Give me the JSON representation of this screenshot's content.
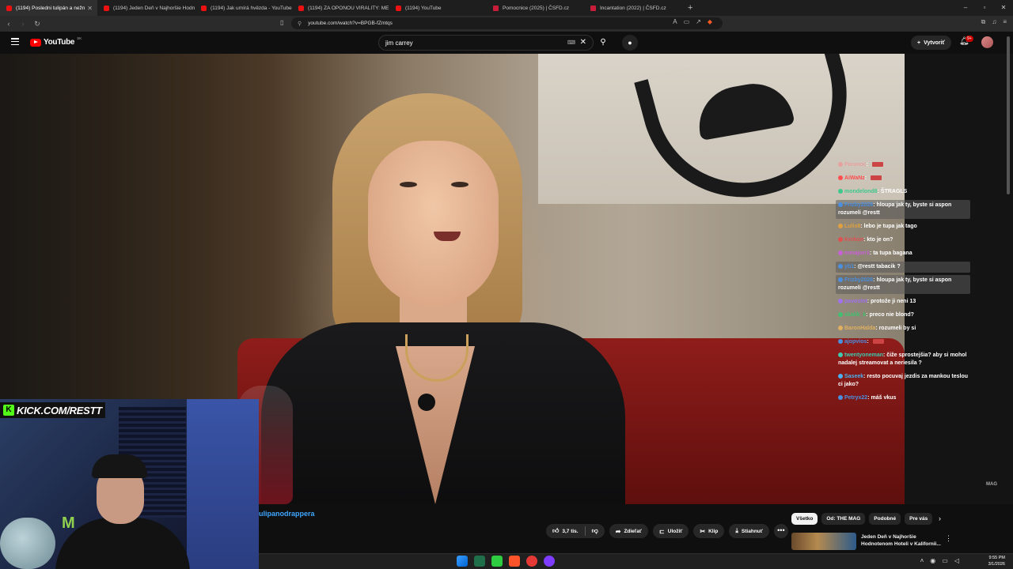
{
  "browser": {
    "tabs": [
      {
        "label": "(1194) Posledni tulipán a nežn",
        "active": true
      },
      {
        "label": "(1194) Jeden Deň v Najhoršie Hodno",
        "active": false
      },
      {
        "label": "(1194) Jak umírá hvězda - YouTube",
        "active": false
      },
      {
        "label": "(1194) ZA OPONOU VIRALITY: MEU",
        "active": false
      },
      {
        "label": "(1194) YouTube",
        "active": false
      },
      {
        "label": "Pomocnice (2025) | ČSFD.cz",
        "active": false
      },
      {
        "label": "Incantation (2022) | ČSFD.cz",
        "active": false
      }
    ],
    "new_tab": "+",
    "url": "youtube.com/watch?v=BPGB-fZmtqs",
    "window_controls": {
      "minimize": "–",
      "maximize": "▫",
      "close": "✕"
    }
  },
  "youtube": {
    "logo_text": "YouTube",
    "country_code": "SK",
    "search_value": "jim carrey",
    "create_label": "Vytvoriť",
    "notif_badge": "9+"
  },
  "chat": [
    {
      "user": "Paranoc",
      "text": "",
      "color": "#e8a0a0",
      "highlight": false,
      "emote": true
    },
    {
      "user": "AiWaNz",
      "text": "",
      "color": "#ff4d4d",
      "highlight": false,
      "emote": true
    },
    {
      "user": "mondelond8",
      "text": "ŠTRAGLS",
      "color": "#3ec98a",
      "highlight": false,
      "emote": false
    },
    {
      "user": "Frizby2026",
      "text": "hloupa jak ty, byste si aspon rozumeli @restt",
      "color": "#4a8fe0",
      "highlight": true,
      "emote": false
    },
    {
      "user": "Lulis8",
      "text": "lebo je tupa jak tago",
      "color": "#e0a040",
      "highlight": false,
      "emote": false
    },
    {
      "user": "Kerkon",
      "text": "kto je on?",
      "color": "#e05050",
      "highlight": false,
      "emote": false
    },
    {
      "user": "mmajorr1",
      "text": "ta tupa bagana",
      "color": "#c860d8",
      "highlight": false,
      "emote": false
    },
    {
      "user": "yb1",
      "text": "@restt tabacik ?",
      "color": "#4a8fe0",
      "highlight": true,
      "emote": false
    },
    {
      "user": "Frizby2026",
      "text": "hloupa jak ty, byste si aspon rozumeli @restt",
      "color": "#4a8fe0",
      "highlight": true,
      "emote": false
    },
    {
      "user": "pavoslot",
      "text": "protože ji neni 13",
      "color": "#a070f0",
      "highlight": false,
      "emote": false
    },
    {
      "user": "skalik_k",
      "text": "preco nie blond?",
      "color": "#40c070",
      "highlight": false,
      "emote": false
    },
    {
      "user": "BaronHalda",
      "text": "rozumeli by si",
      "color": "#e0b060",
      "highlight": false,
      "emote": false
    },
    {
      "user": "ajopvios",
      "text": "",
      "color": "#4a8fe0",
      "highlight": false,
      "emote": true
    },
    {
      "user": "twentyoneman",
      "text": "čiže sprostejšia? aby si mohol nadalej streamovat a neriesila ?",
      "color": "#3ec9b0",
      "highlight": false,
      "emote": false
    },
    {
      "user": "Saseek",
      "text": "resto pocuvaj jezdis za mankou teslou ci jako?",
      "color": "#4ab0f0",
      "highlight": false,
      "emote": false
    },
    {
      "user": "Petryx22",
      "text": "máš vkus",
      "color": "#4a8fe0",
      "highlight": false,
      "emote": false
    }
  ],
  "overlay": {
    "kick_text": "KICK.COM/RESTT",
    "kick_k": "K",
    "watermark": "MAG"
  },
  "video": {
    "title_link": "ulipanodrappera",
    "likes": "3,7 tis.",
    "share": "Zdieľať",
    "save": "Uložiť",
    "clip": "Klip",
    "download": "Stiahnuť",
    "more": "•••"
  },
  "chips": [
    "Všetko",
    "Od: THE MAG",
    "Podobné",
    "Pre vás"
  ],
  "recommendation": {
    "title": "Jeden Deň v Najhoršie Hodnotenom Hoteli v Kalifornii..."
  },
  "taskbar": {
    "time": "9:55 PM",
    "date": "3/1/2026"
  },
  "icons": {
    "back": "back-arrow-icon",
    "reload": "reload-icon",
    "search": "search-icon",
    "mic": "microphone-icon",
    "bell": "bell-icon"
  }
}
